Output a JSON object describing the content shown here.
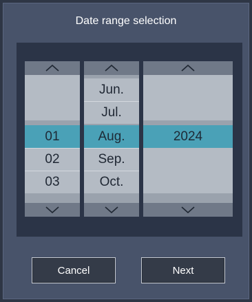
{
  "dialog": {
    "title": "Date range selection"
  },
  "picker": {
    "day": {
      "items": [
        "",
        "",
        "01",
        "02",
        "03"
      ],
      "selected_index": 2
    },
    "month": {
      "items": [
        "Jun.",
        "Jul.",
        "Aug.",
        "Sep.",
        "Oct."
      ],
      "selected_index": 2
    },
    "year": {
      "items": [
        "",
        "",
        "2024",
        "",
        ""
      ],
      "selected_index": 2
    }
  },
  "buttons": {
    "cancel_label": "Cancel",
    "next_label": "Next"
  }
}
